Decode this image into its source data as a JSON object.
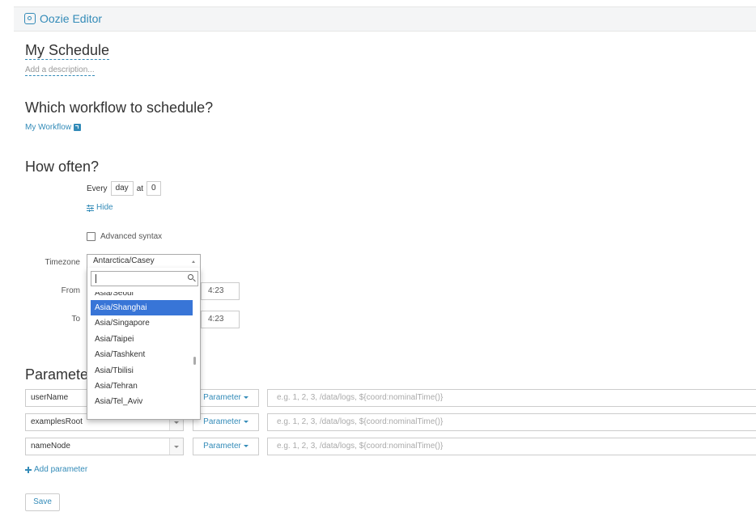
{
  "app": {
    "title": "Oozie Editor",
    "icon": "oozie-circle-icon"
  },
  "schedule": {
    "name": "My Schedule",
    "description_placeholder": "Add a description..."
  },
  "workflow_section": {
    "heading": "Which workflow to schedule?",
    "workflow_link": "My Workflow",
    "link_icon": "external-link-icon"
  },
  "frequency": {
    "heading": "How often?",
    "every_label": "Every",
    "unit": "day",
    "at_label": "at",
    "at_value": "0",
    "hide_label": "Hide",
    "advanced_label": "Advanced syntax",
    "advanced_checked": false
  },
  "timezone": {
    "label": "Timezone",
    "selected": "Antarctica/Casey",
    "search_value": "",
    "clipped_item": "Asia/Seoul",
    "options": [
      "Asia/Shanghai",
      "Asia/Singapore",
      "Asia/Taipei",
      "Asia/Tashkent",
      "Asia/Tbilisi",
      "Asia/Tehran",
      "Asia/Tel_Aviv"
    ],
    "highlighted": "Asia/Shanghai"
  },
  "range": {
    "from_label": "From",
    "from_time": "4:23",
    "to_label": "To",
    "to_time": "4:23"
  },
  "parameters": {
    "heading": "Parameters",
    "rows": [
      {
        "name": "userName",
        "type_label": "Parameter",
        "value_placeholder": "e.g. 1, 2, 3, /data/logs, ${coord:nominalTime()}"
      },
      {
        "name": "examplesRoot",
        "type_label": "Parameter",
        "value_placeholder": "e.g. 1, 2, 3, /data/logs, ${coord:nominalTime()}"
      },
      {
        "name": "nameNode",
        "type_label": "Parameter",
        "value_placeholder": "e.g. 1, 2, 3, /data/logs, ${coord:nominalTime()}"
      }
    ],
    "add_label": "Add parameter"
  },
  "actions": {
    "save_label": "Save"
  },
  "colors": {
    "link": "#338bb8",
    "highlight": "#3875d7"
  }
}
